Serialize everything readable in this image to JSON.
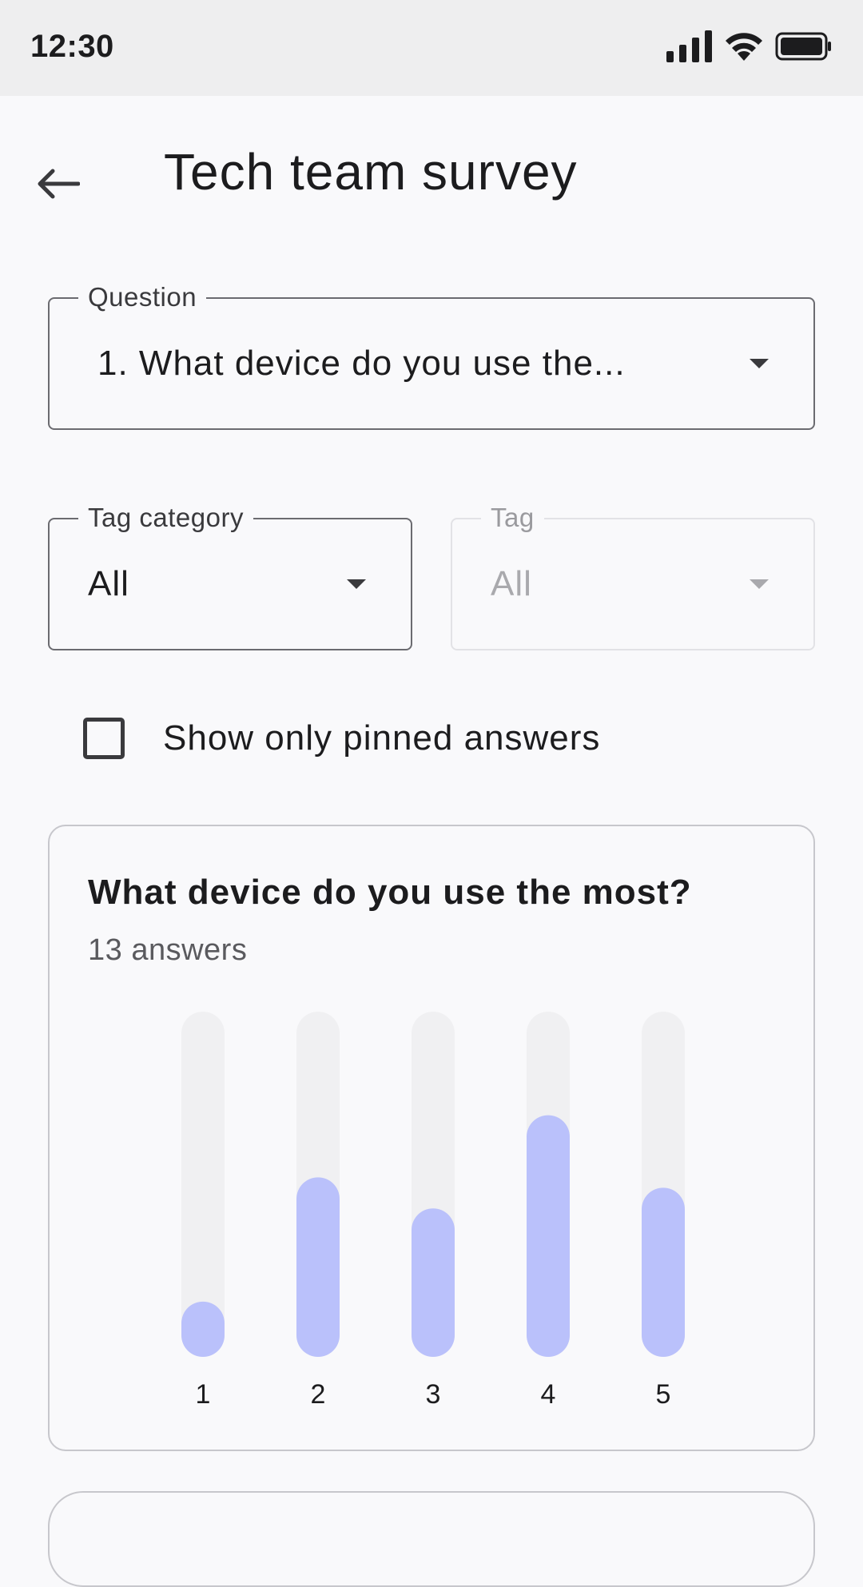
{
  "status_bar": {
    "time": "12:30"
  },
  "header": {
    "title": "Tech team survey"
  },
  "filters": {
    "question": {
      "legend": "Question",
      "value": "1. What device do you use the..."
    },
    "tag_category": {
      "legend": "Tag category",
      "value": "All"
    },
    "tag": {
      "legend": "Tag",
      "value": "All",
      "disabled": true
    },
    "pinned_checkbox": {
      "label": "Show only pinned answers",
      "checked": false
    }
  },
  "result_card": {
    "title": "What device do you use the most?",
    "subtitle": "13 answers"
  },
  "colors": {
    "bar_fill": "#bac1fb",
    "bar_track": "#f0f0f2",
    "background": "#f9f9fb"
  },
  "chart_data": {
    "type": "bar",
    "categories": [
      "1",
      "2",
      "3",
      "4",
      "5"
    ],
    "values": [
      0.16,
      0.52,
      0.43,
      0.7,
      0.49
    ],
    "ylim": [
      0,
      1
    ],
    "grid": false
  }
}
